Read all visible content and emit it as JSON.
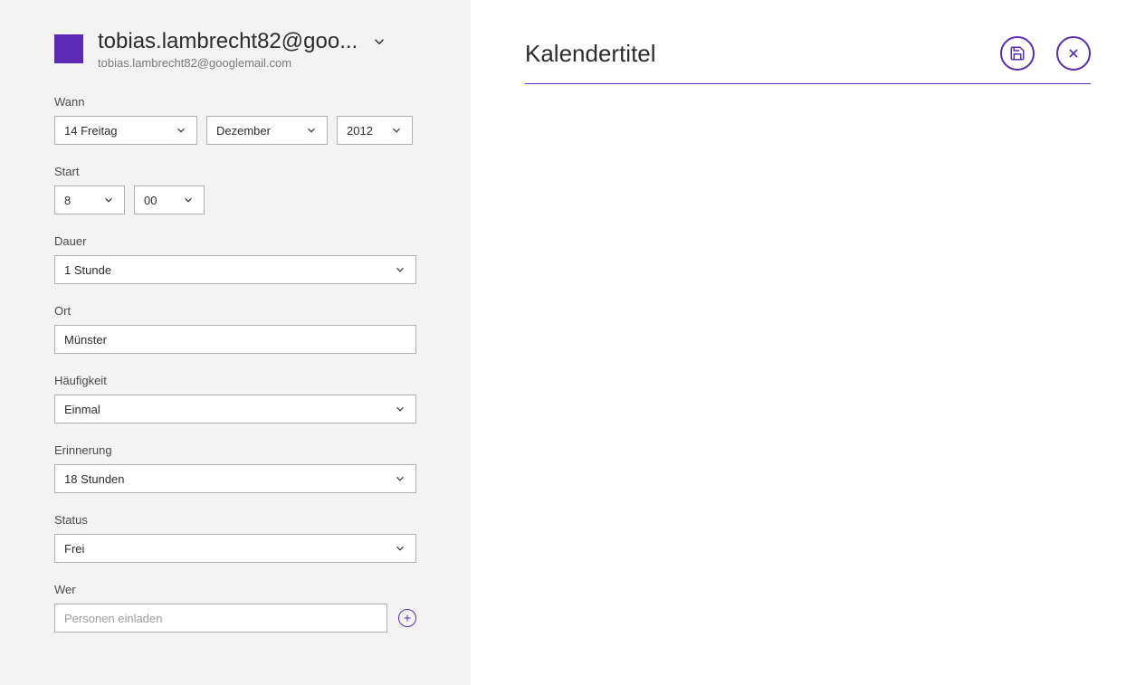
{
  "account": {
    "display_name": "tobias.lambrecht82@goo...",
    "email": "tobias.lambrecht82@googlemail.com",
    "color": "#5b2bb5"
  },
  "labels": {
    "when": "Wann",
    "start": "Start",
    "duration": "Dauer",
    "location": "Ort",
    "frequency": "Häufigkeit",
    "reminder": "Erinnerung",
    "status": "Status",
    "who": "Wer"
  },
  "values": {
    "day": "14 Freitag",
    "month": "Dezember",
    "year": "2012",
    "hour": "8",
    "minute": "00",
    "duration": "1 Stunde",
    "location": "Münster",
    "frequency": "Einmal",
    "reminder": "18 Stunden",
    "status": "Frei",
    "who_placeholder": "Personen einladen"
  },
  "right": {
    "title_placeholder": "Kalendertitel"
  }
}
